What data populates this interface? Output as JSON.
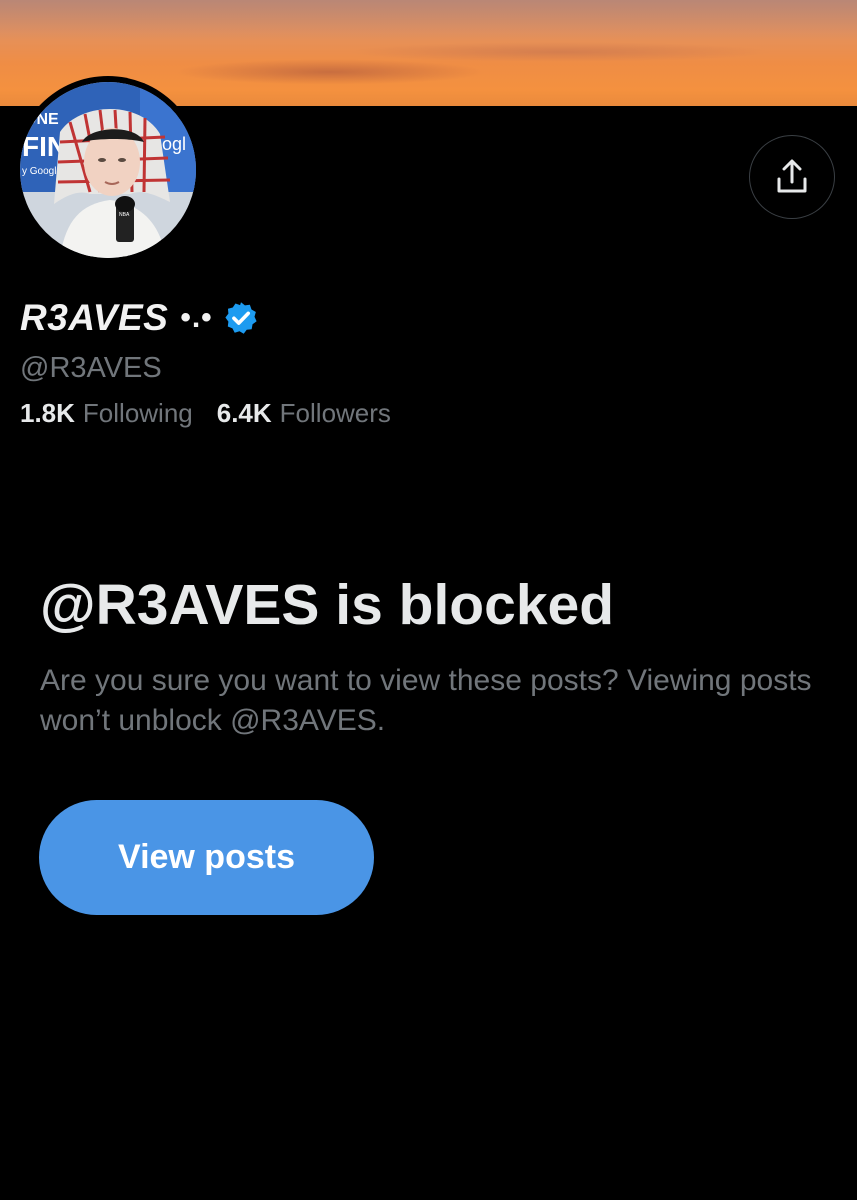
{
  "profile": {
    "display_name": "R3AVES",
    "name_decoration": "•.•",
    "handle": "@R3AVES",
    "following_count": "1.8K",
    "following_label": "Following",
    "followers_count": "6.4K",
    "followers_label": "Followers",
    "verified": true,
    "avatar_overlay_text": {
      "left_line1": "ONE",
      "left_line2": "FINA",
      "left_line3": "y Google Pi",
      "right_line1": "ogl"
    }
  },
  "blocked": {
    "title": "@R3AVES is blocked",
    "description": "Are you sure you want to view these posts? Viewing posts won’t unblock @R3AVES.",
    "button_label": "View posts"
  },
  "icons": {
    "share": "share-icon",
    "verified": "verified-badge-icon"
  },
  "colors": {
    "background": "#000000",
    "accent": "#4a95e6",
    "secondary_text": "#71767b",
    "verified": "#1d9bf0",
    "banner": "#f4913f"
  }
}
